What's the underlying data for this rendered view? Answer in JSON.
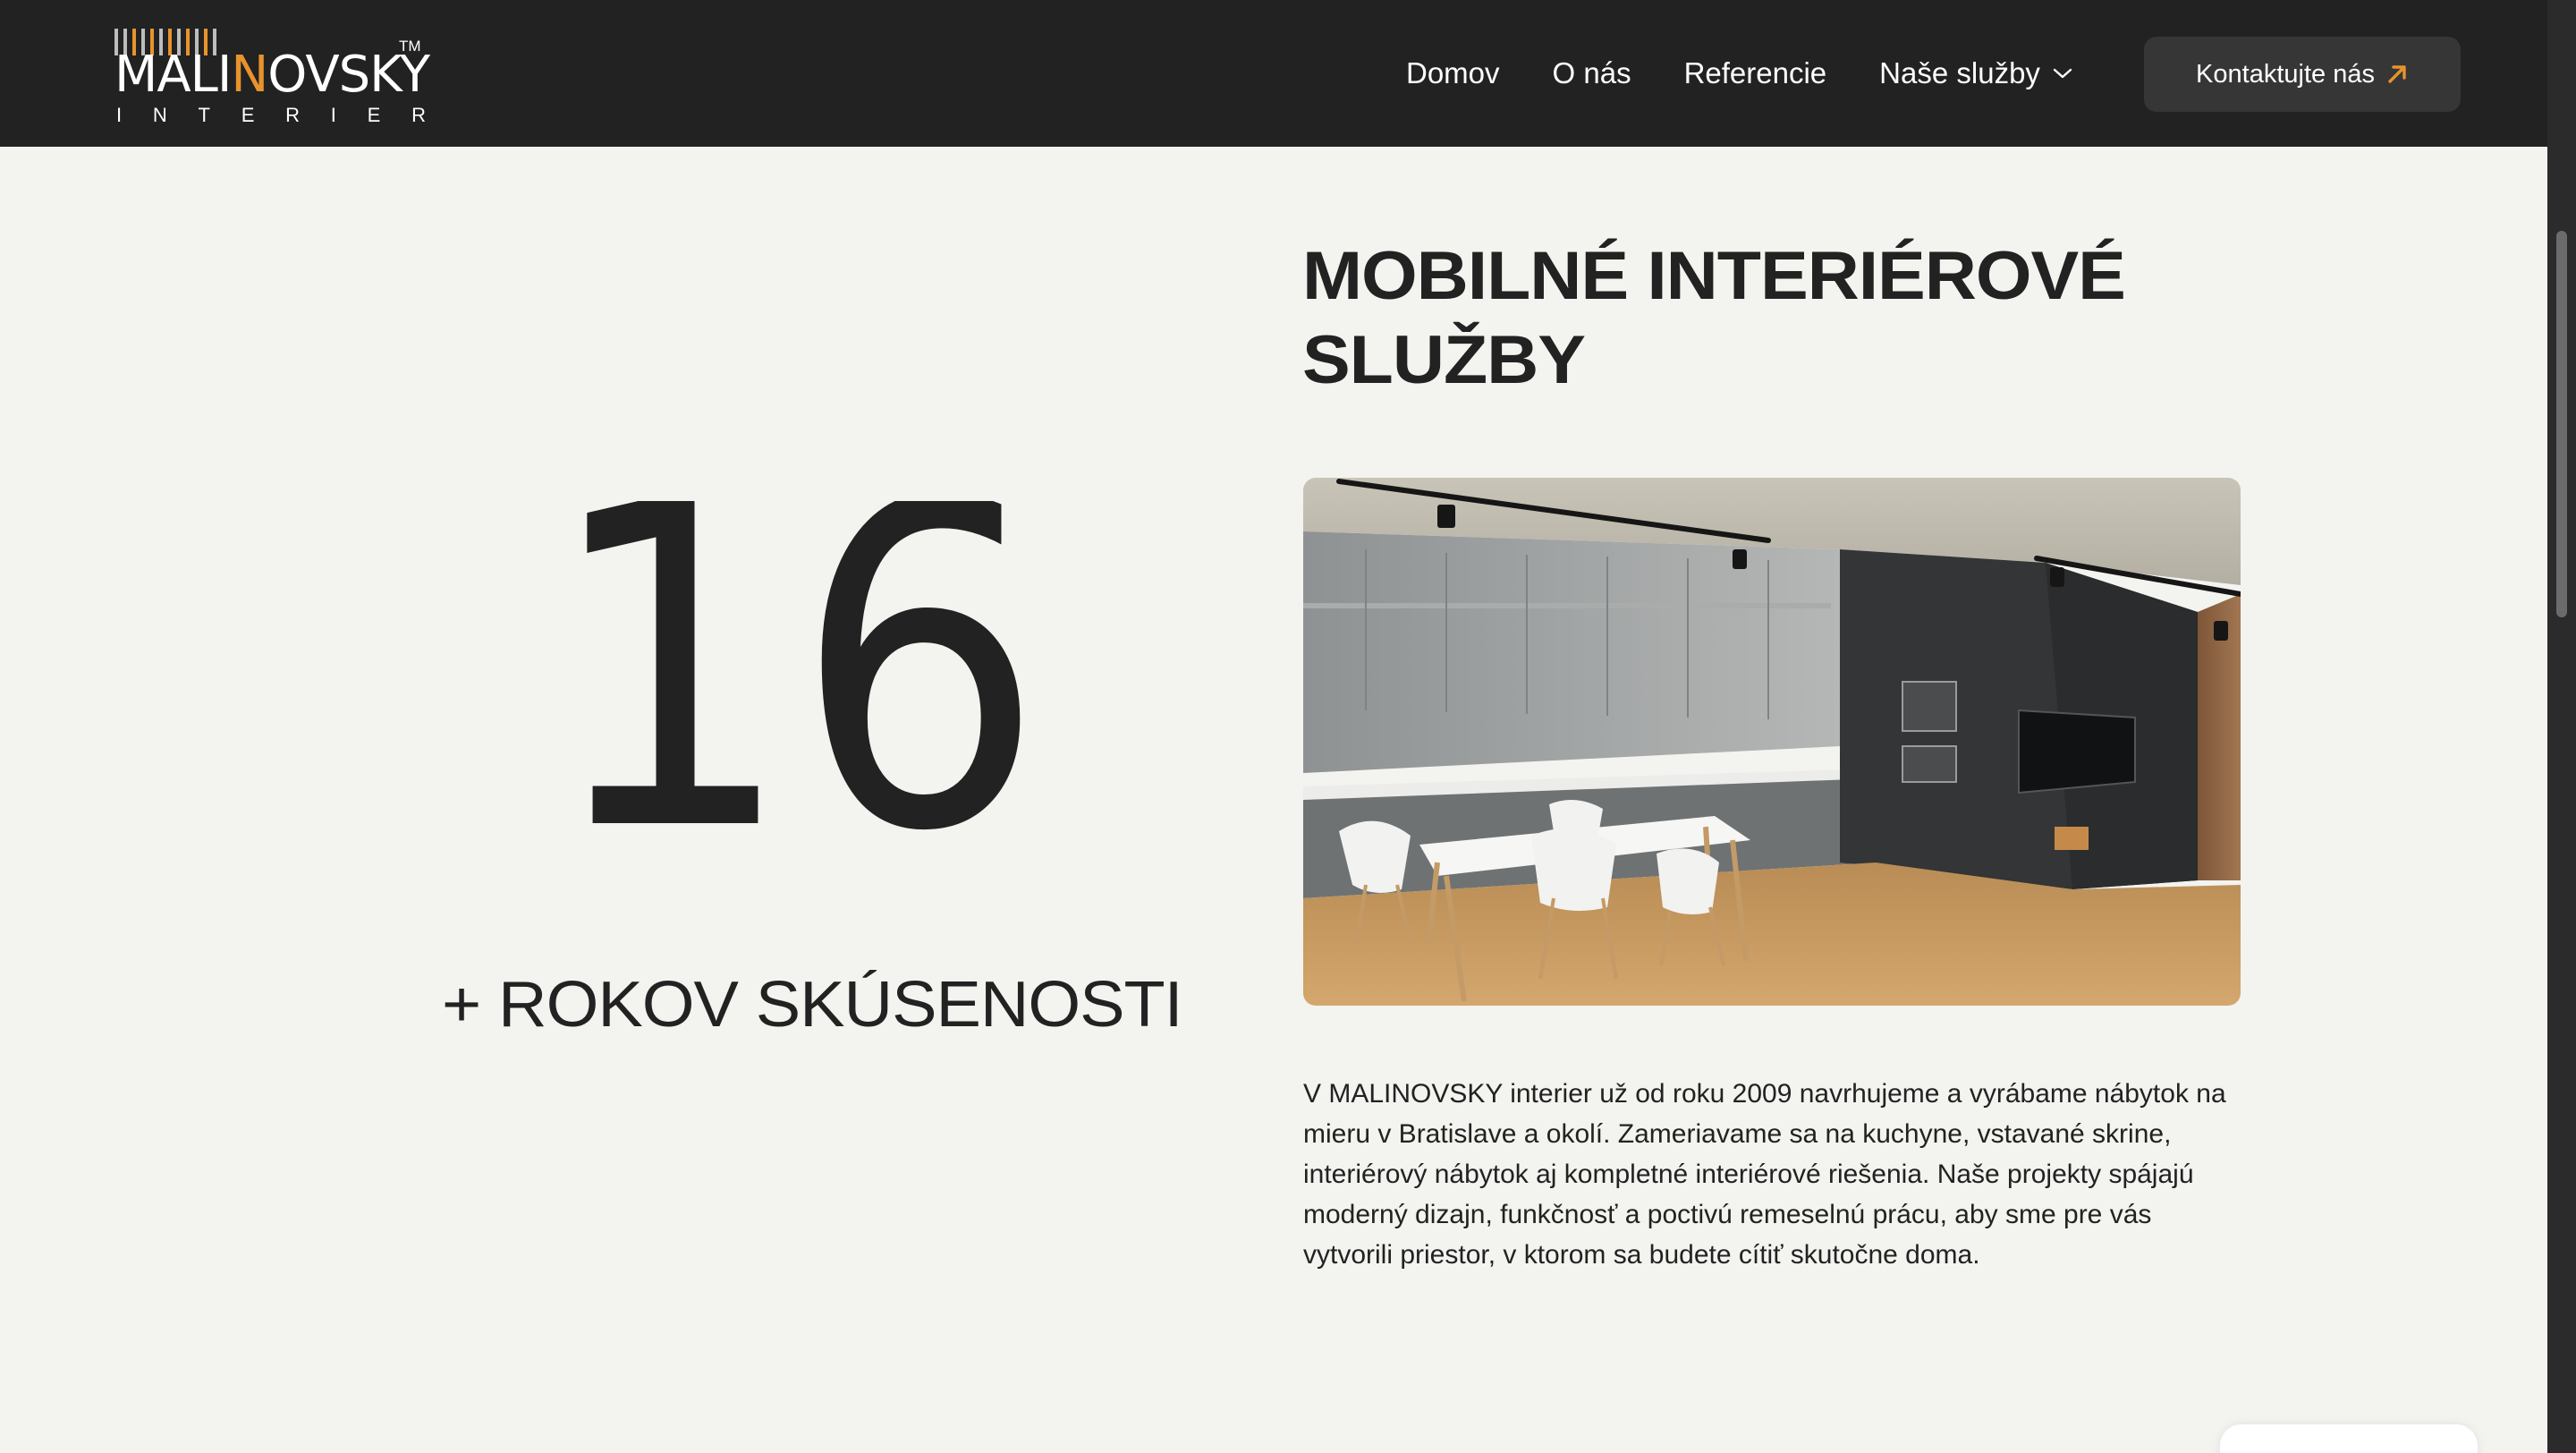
{
  "brand": {
    "name_pre": "MAL",
    "name_accent": "N",
    "name_post": "OVSKY",
    "name_i": "I",
    "tagline_letters": [
      "I",
      "N",
      "T",
      "E",
      "R",
      "I",
      "E",
      "R"
    ],
    "trademark": "TM",
    "accent_color": "#e8932e"
  },
  "nav": {
    "items": [
      {
        "label": "Domov"
      },
      {
        "label": "O nás"
      },
      {
        "label": "Referencie"
      },
      {
        "label": "Naše služby",
        "icon": "chevron-down-icon"
      }
    ],
    "cta_label": "Kontaktujte nás",
    "cta_icon": "arrow-up-right-icon"
  },
  "stat": {
    "number": "16",
    "label": "+ ROKOV SKÚSENOSTI"
  },
  "section": {
    "title_line1": "MOBILNÉ INTERIÉROVÉ",
    "title_line2": "SLUŽBY",
    "body": "V MALINOVSKY interier už od roku 2009 navrhujeme a vyrábame nábytok na mieru v Bratislave a okolí. Zameriavame sa na kuchyne, vstavané skrine, interiérový nábytok aj kompletné interiérové riešenia. Naše projekty spájajú moderný dizajn, funkčnosť a poctivú remeselnú prácu, aby sme pre vás vytvorili priestor, v ktorom sa budete cítiť skutočne doma."
  },
  "colors": {
    "header_bg": "#222222",
    "page_bg": "#f3f3ef",
    "cta_bg": "#363636",
    "text": "#222222"
  }
}
